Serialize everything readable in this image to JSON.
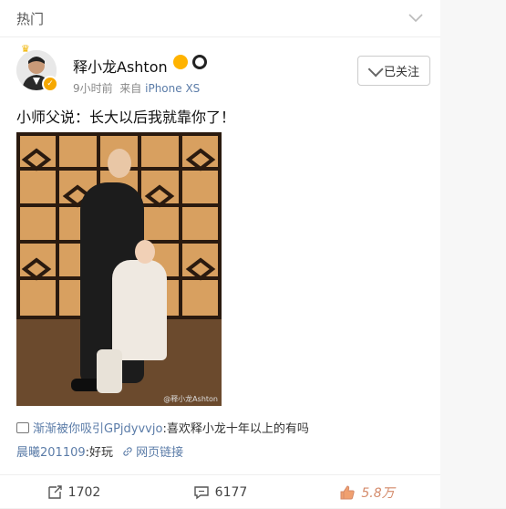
{
  "header": {
    "title": "热门"
  },
  "post": {
    "user_name": "释小龙Ashton",
    "time": "9小时前",
    "source_prefix": "来自",
    "source": "iPhone XS",
    "follow_label": "已关注",
    "text": "小师父说：长大以后我就靠你了！",
    "image_watermark": "@释小龙Ashton"
  },
  "comments": [
    {
      "user": "渐渐被你吸引GPjdyvvjo",
      "text": ":喜欢释小龙十年以上的有吗"
    },
    {
      "user": "晨曦201109",
      "text": ":好玩",
      "link": "网页链接"
    }
  ],
  "actions": {
    "repost_count": "1702",
    "comment_count": "6177",
    "like_count": "5.8万"
  },
  "colors": {
    "link": "#5b7ca8",
    "vip": "#f6a800"
  }
}
